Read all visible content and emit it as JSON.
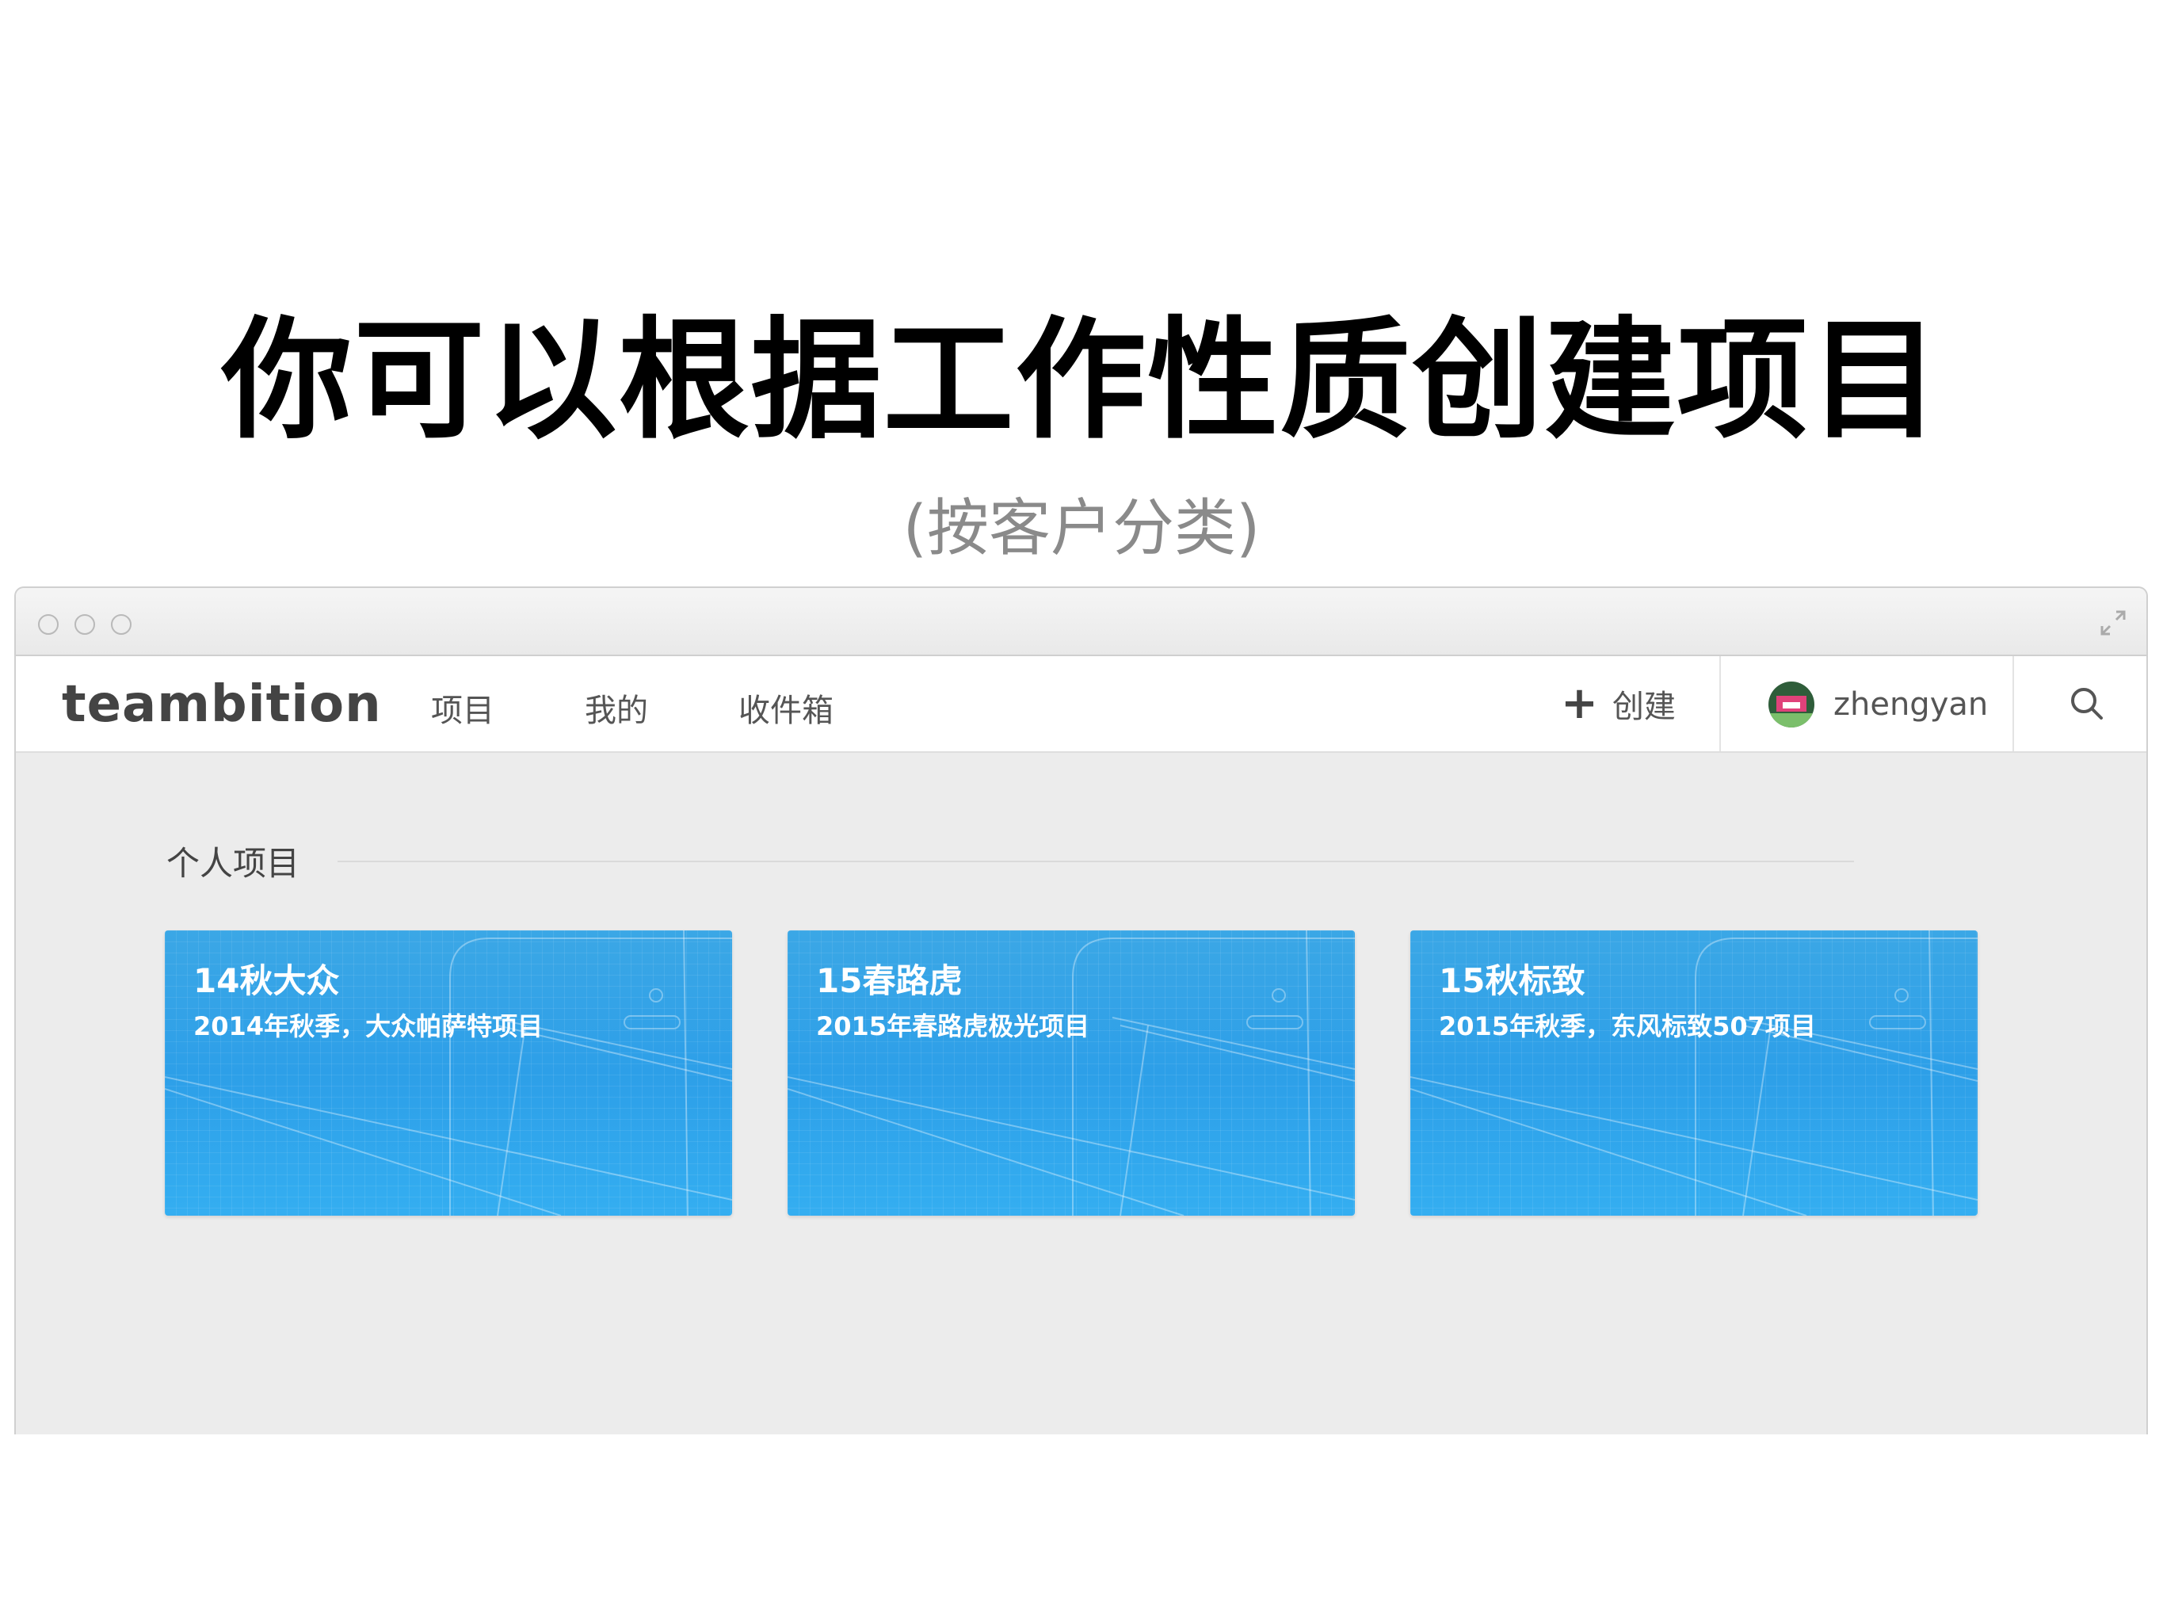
{
  "slide": {
    "title": "你可以根据工作性质创建项目",
    "subtitle": "(按客户分类)"
  },
  "app": {
    "logo": "teambition",
    "nav": [
      {
        "label": "项目"
      },
      {
        "label": "我的"
      },
      {
        "label": "收件箱"
      }
    ],
    "create_label": "创建",
    "user": {
      "name": "zhengyan"
    }
  },
  "section": {
    "title": "个人项目"
  },
  "projects": [
    {
      "name": "14秋大众",
      "description": "2014年秋季，大众帕萨特项目"
    },
    {
      "name": "15春路虎",
      "description": "2015年春路虎极光项目"
    },
    {
      "name": "15秋标致",
      "description": "2015年秋季，东风标致507项目"
    }
  ],
  "colors": {
    "card_blue": "#2d9fe8",
    "window_bg": "#ececec",
    "nav_text": "#555555"
  },
  "icons": {
    "traffic_lights": "window-control-icons",
    "expand": "fullscreen-icon",
    "create": "plus-icon",
    "search": "search-icon"
  }
}
